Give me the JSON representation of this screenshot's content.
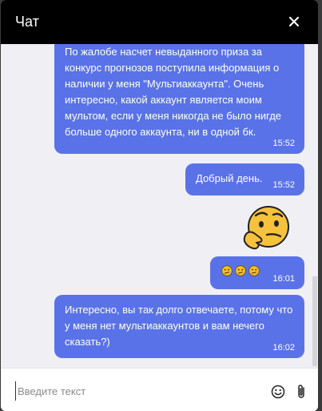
{
  "chat": {
    "title": "Чат"
  },
  "messages": [
    {
      "text": "По жалобе насчет невыданного приза за конкурс прогнозов поступила информация о наличии у меня \"Мультиаккаунта\". Очень интересно, какой аккаунт является моим мультом, если у меня никогда не было нигде больше одного аккаунта, ни в одной бк.",
      "time": "15:52"
    },
    {
      "text": "Добрый день.",
      "time": "15:52"
    },
    {
      "sticker": "thinking-face-sticker"
    },
    {
      "emojis": [
        "confused-face-icon",
        "confused-face-icon",
        "confused-face-icon"
      ],
      "time": "16:01"
    },
    {
      "text": "Интересно, вы так долго отвечаете, потому что у меня нет мультиаккаунтов и вам нечего сказать?)",
      "time": "16:02"
    }
  ],
  "composer": {
    "placeholder": "Введите текст"
  },
  "colors": {
    "header_bg": "#000000",
    "bubble": "#5a72e8",
    "chat_bg": "#f0f0f4"
  }
}
